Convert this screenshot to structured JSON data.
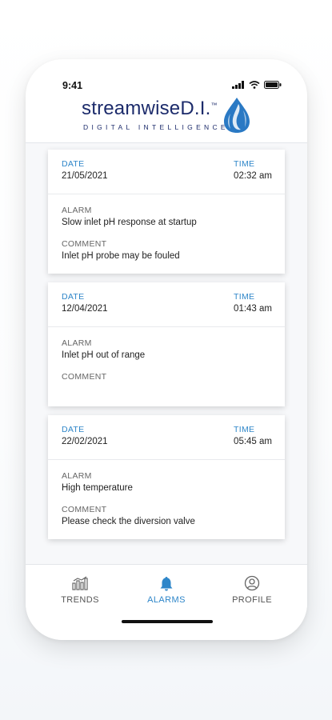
{
  "status_bar": {
    "time": "9:41"
  },
  "brand": {
    "name_main": "streamwise",
    "name_suffix": "D.I.",
    "trademark": "™",
    "tagline": "DIGITAL INTELLIGENCE"
  },
  "labels": {
    "date": "DATE",
    "time": "TIME",
    "alarm": "ALARM",
    "comment": "COMMENT"
  },
  "alarms": [
    {
      "date": "21/05/2021",
      "time": "02:32 am",
      "alarm": "Slow inlet pH response at startup",
      "comment": "Inlet pH probe may be fouled"
    },
    {
      "date": "12/04/2021",
      "time": "01:43 am",
      "alarm": "Inlet pH out of range",
      "comment": ""
    },
    {
      "date": "22/02/2021",
      "time": "05:45 am",
      "alarm": "High temperature",
      "comment": "Please check the diversion valve"
    }
  ],
  "tabs": [
    {
      "label": "TRENDS",
      "icon": "trends-chart-icon",
      "active": false
    },
    {
      "label": "ALARMS",
      "icon": "bell-icon",
      "active": true
    },
    {
      "label": "PROFILE",
      "icon": "user-circle-icon",
      "active": false
    }
  ],
  "colors": {
    "accent": "#2e86c9",
    "brand_navy": "#1c2b6b",
    "background": "#f7f8fa"
  }
}
